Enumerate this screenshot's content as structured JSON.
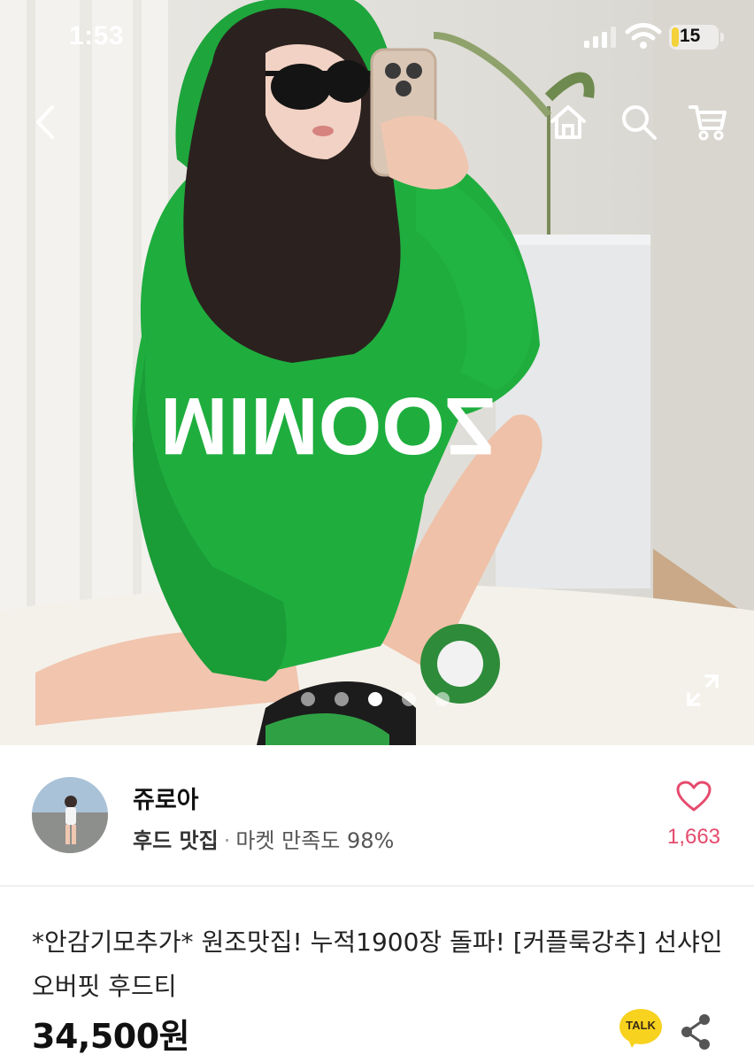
{
  "status_bar": {
    "time": "1:53",
    "battery": "15"
  },
  "nav": {
    "icons": [
      "back-icon",
      "home-icon",
      "search-icon",
      "cart-icon"
    ]
  },
  "hero": {
    "hoodie_text": "MIMOOZ",
    "carousel": {
      "count": 5,
      "active_index": 2
    }
  },
  "seller": {
    "name": "쥬로아",
    "category": "후드 맛집",
    "separator": "·",
    "satisfaction": "마켓 만족도 98%",
    "like_count": "1,663"
  },
  "product": {
    "title": "*안감기모추가* 원조맛집! 누적1900장 돌파! [커플룩강추] 선샤인 오버핏 후드티",
    "price": "34,500원",
    "talk_label": "TALK"
  },
  "colors": {
    "like": "#e54b6d",
    "talk": "#f7d21e",
    "hoodie": "#1fae3e"
  }
}
